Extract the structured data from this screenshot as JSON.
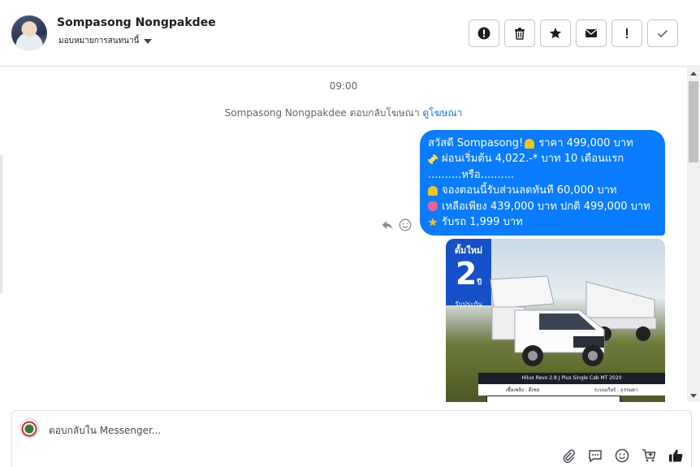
{
  "header": {
    "name": "Sompasong Nongpakdee",
    "assign_label": "มอบหมายการสนทนานี้"
  },
  "toolbar": {
    "buttons": [
      {
        "icon": "alert-circle-icon",
        "name": "spam-button"
      },
      {
        "icon": "trash-icon",
        "name": "delete-button"
      },
      {
        "icon": "star-icon",
        "name": "follow-up-button"
      },
      {
        "icon": "envelope-icon",
        "name": "mark-unread-button"
      },
      {
        "icon": "exclamation-icon",
        "name": "priority-button"
      },
      {
        "icon": "check-icon",
        "name": "done-button"
      }
    ]
  },
  "thread": {
    "time": "09:00",
    "reply_note": {
      "text": "Sompasong Nongpakdee ตอบกลับโฆษณา",
      "link": "ดูโฆษณา"
    },
    "message": {
      "lines": [
        {
          "emoji": "",
          "text": "สวัสดี Sompasong! ",
          "emoji_after": "bell-emoji",
          "text_after": " ราคา 499,000 บาท"
        },
        {
          "emoji": "sparkles-emoji",
          "text": "ผ่อนเริ่มต้น 4,022.-* บาท 10 เดือนแรก"
        },
        {
          "emoji": "",
          "text": "..........หรือ.........."
        },
        {
          "emoji": "bell-emoji",
          "text": "จองตอนนี้รับส่วนลดทันที 60,000 บาท"
        },
        {
          "emoji": "ribbon-emoji",
          "text": "เหลือเพียง 439,000 บาท ปกติ 499,000 บาท"
        },
        {
          "emoji": "star-emoji",
          "text": "รับรถ 1,999 บาท"
        }
      ]
    },
    "ad_image": {
      "badge_top": "ดั้มใหม่",
      "badge_number": "2",
      "badge_suffix": "ปี",
      "badge_bottom": "รับประกัน",
      "caption": "Hilux Revo 2.8 J Plus Single Cab MT 2020",
      "spec_fuel": "เชื้อเพลิง : ดีเซล",
      "spec_gear": "ระบบเกียร์ : ธรรมดา"
    }
  },
  "composer": {
    "placeholder": "ตอบกลับใน Messenger..."
  },
  "colors": {
    "bubble": "#0a7cff",
    "link": "#1877f2",
    "border": "#dddfe2"
  }
}
